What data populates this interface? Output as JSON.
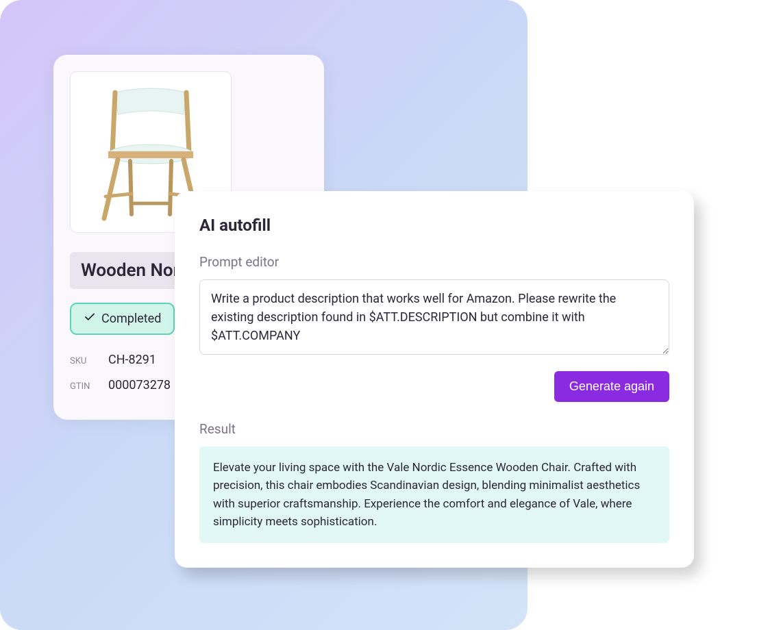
{
  "product": {
    "name": "Wooden Nor",
    "status_label": "Completed",
    "meta": {
      "sku_label": "SKU",
      "sku_value": "CH-8291",
      "gtin_label": "GTIN",
      "gtin_value": "000073278"
    }
  },
  "autofill": {
    "title": "AI autofill",
    "prompt_section_label": "Prompt editor",
    "prompt_text": "Write a product description that works well for Amazon. Please rewrite the existing description found in $ATT.DESCRIPTION but combine it with $ATT.COMPANY",
    "generate_button_label": "Generate again",
    "result_section_label": "Result",
    "result_text": "Elevate your living space with the Vale Nordic Essence Wooden Chair. Crafted with precision, this chair embodies Scandinavian design, blending minimalist aesthetics with superior craftsmanship. Experience the comfort and elegance of Vale, where simplicity meets sophistication."
  },
  "colors": {
    "accent": "#8a2be2",
    "status_bg": "#d1f6e9",
    "status_border": "#5fd3b5",
    "result_bg": "#e2f8f7"
  }
}
